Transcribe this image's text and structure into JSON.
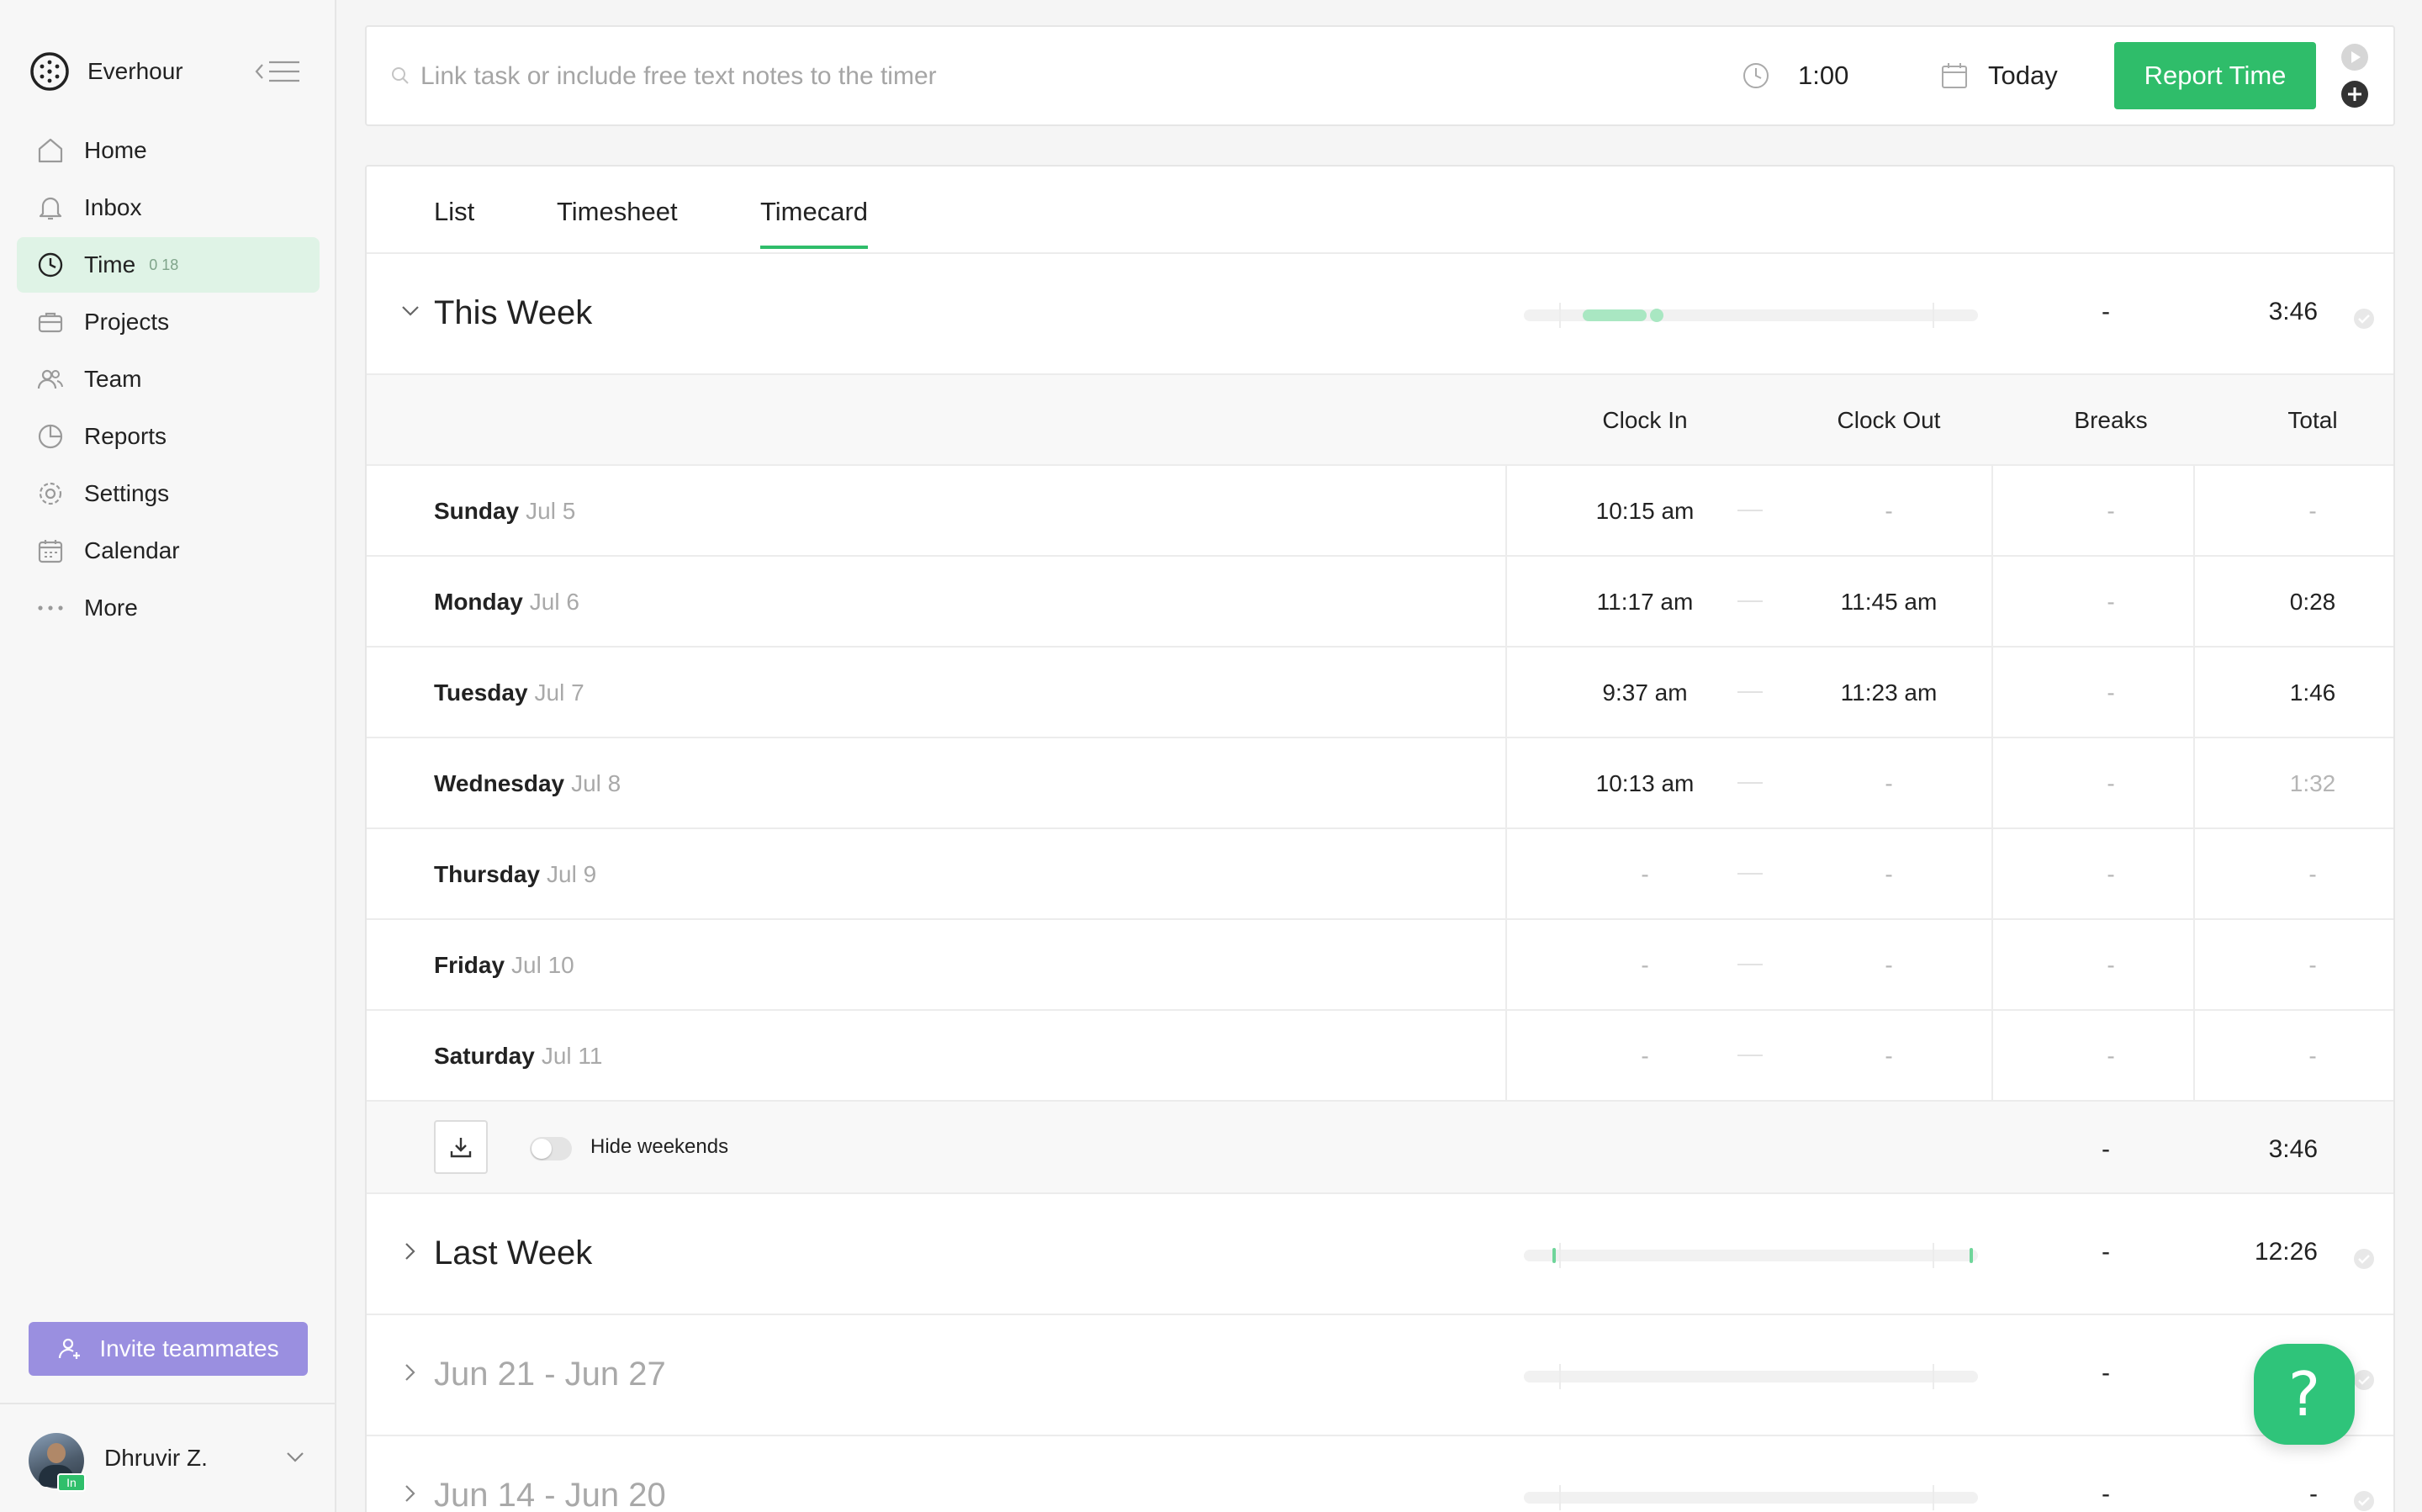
{
  "app": {
    "name": "Everhour"
  },
  "sidebar": {
    "items": [
      {
        "label": "Home",
        "icon": "home-icon"
      },
      {
        "label": "Inbox",
        "icon": "bell-icon"
      },
      {
        "label": "Time",
        "icon": "clock-icon",
        "badge": "0 18",
        "active": true
      },
      {
        "label": "Projects",
        "icon": "briefcase-icon"
      },
      {
        "label": "Team",
        "icon": "team-icon"
      },
      {
        "label": "Reports",
        "icon": "pie-chart-icon"
      },
      {
        "label": "Settings",
        "icon": "gear-icon"
      },
      {
        "label": "Calendar",
        "icon": "calendar-icon"
      },
      {
        "label": "More",
        "icon": "more-dots-icon"
      }
    ],
    "invite_label": "Invite teammates",
    "user": {
      "name": "Dhruvir Z.",
      "status": "In"
    }
  },
  "timer": {
    "placeholder": "Link task or include free text notes to the timer",
    "duration": "1:00",
    "date": "Today",
    "report_label": "Report Time"
  },
  "tabs": [
    {
      "label": "List",
      "active": false
    },
    {
      "label": "Timesheet",
      "active": false
    },
    {
      "label": "Timecard",
      "active": true
    }
  ],
  "this_week": {
    "title": "This Week",
    "breaks": "-",
    "total": "3:46",
    "columns": [
      "Clock In",
      "Clock Out",
      "Breaks",
      "Total"
    ],
    "days": [
      {
        "name": "Sunday",
        "date": "Jul 5",
        "clock_in": "10:15 am",
        "clock_out": "-",
        "breaks": "-",
        "total": "-"
      },
      {
        "name": "Monday",
        "date": "Jul 6",
        "clock_in": "11:17 am",
        "clock_out": "11:45 am",
        "breaks": "-",
        "total": "0:28"
      },
      {
        "name": "Tuesday",
        "date": "Jul 7",
        "clock_in": "9:37 am",
        "clock_out": "11:23 am",
        "breaks": "-",
        "total": "1:46"
      },
      {
        "name": "Wednesday",
        "date": "Jul 8",
        "clock_in": "10:13 am",
        "clock_out": "-",
        "breaks": "-",
        "total": "1:32"
      },
      {
        "name": "Thursday",
        "date": "Jul 9",
        "clock_in": "-",
        "clock_out": "-",
        "breaks": "-",
        "total": "-"
      },
      {
        "name": "Friday",
        "date": "Jul 10",
        "clock_in": "-",
        "clock_out": "-",
        "breaks": "-",
        "total": "-"
      },
      {
        "name": "Saturday",
        "date": "Jul 11",
        "clock_in": "-",
        "clock_out": "-",
        "breaks": "-",
        "total": "-"
      }
    ],
    "hide_weekends_label": "Hide weekends",
    "footer_breaks": "-",
    "footer_total": "3:46"
  },
  "other_weeks": [
    {
      "title": "Last Week",
      "breaks": "-",
      "total": "12:26"
    },
    {
      "title": "Jun 21 - Jun 27",
      "breaks": "-",
      "total": ""
    },
    {
      "title": "Jun 14 - Jun 20",
      "breaks": "-",
      "total": "-"
    }
  ],
  "colors": {
    "accent": "#2fbd6a",
    "active_nav": "#dff3e6",
    "invite": "#9a8fe0",
    "help": "#2fc47a"
  }
}
